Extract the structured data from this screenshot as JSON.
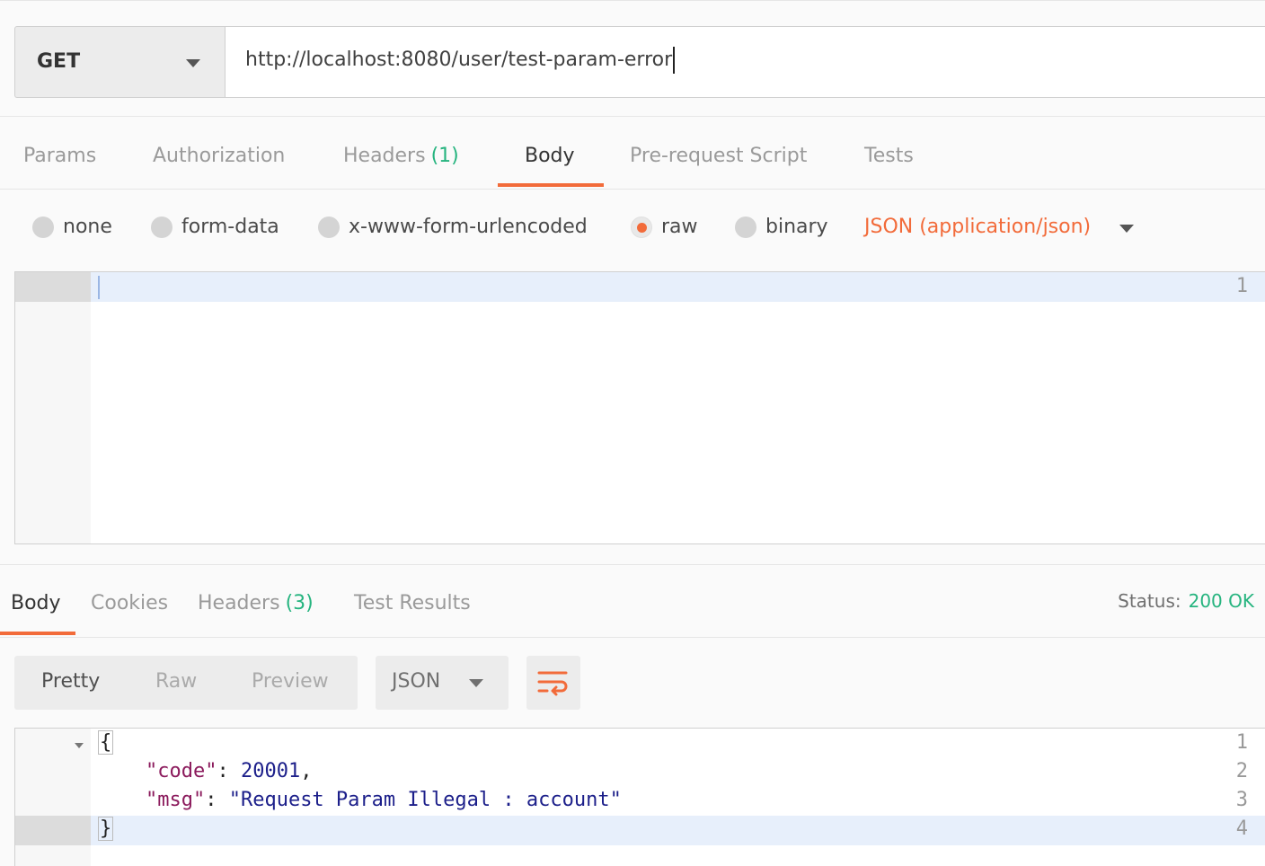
{
  "request": {
    "method": "GET",
    "url": "http://localhost:8080/user/test-param-error"
  },
  "request_tabs": [
    {
      "label": "Params"
    },
    {
      "label": "Authorization"
    },
    {
      "label": "Headers",
      "count": "(1)"
    },
    {
      "label": "Body",
      "active": true
    },
    {
      "label": "Pre-request Script"
    },
    {
      "label": "Tests"
    }
  ],
  "body_types": {
    "options": [
      "none",
      "form-data",
      "x-www-form-urlencoded",
      "raw",
      "binary"
    ],
    "selected": "raw",
    "content_type": "JSON (application/json)"
  },
  "request_editor": {
    "line_numbers": [
      "1"
    ]
  },
  "response_tabs": [
    {
      "label": "Body",
      "active": true
    },
    {
      "label": "Cookies"
    },
    {
      "label": "Headers",
      "count": "(3)"
    },
    {
      "label": "Test Results"
    }
  ],
  "status": {
    "label": "Status:",
    "value": "200 OK"
  },
  "response_toolbar": {
    "views": [
      "Pretty",
      "Raw",
      "Preview"
    ],
    "selected_view": "Pretty",
    "format": "JSON"
  },
  "response_editor": {
    "line_numbers": [
      "1",
      "2",
      "3",
      "4"
    ],
    "lines": {
      "open": "{",
      "code_key": "\"code\"",
      "code_colon": ": ",
      "code_value": "20001",
      "code_comma": ",",
      "msg_key": "\"msg\"",
      "msg_colon": ": ",
      "msg_value": "\"Request Param Illegal : account\"",
      "close": "}"
    }
  },
  "colors": {
    "accent": "#f26b3a",
    "success": "#26b47f"
  }
}
